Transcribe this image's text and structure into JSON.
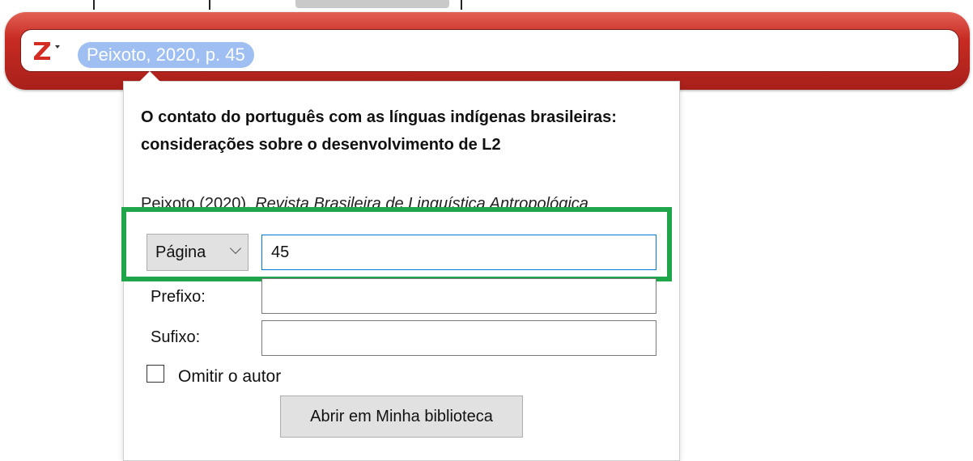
{
  "citation": {
    "bubble_text": "Peixoto, 2020, p. 45",
    "logo_letter": "Z",
    "logo_color": "#d42c23",
    "bar_color": "#b8231c",
    "bubble_color": "#9fbff2"
  },
  "popup": {
    "title": "O contato do português com as línguas indígenas brasileiras: considerações sobre o desenvolvimento de L2",
    "source_author": "Peixoto (2020), ",
    "source_journal": "Revista Brasileira de Linguística Antropológica",
    "locator_label": "Página",
    "locator_value": "45",
    "prefix_label": "Prefixo:",
    "prefix_value": "",
    "suffix_label": "Sufixo:",
    "suffix_value": "",
    "omit_author_label": "Omitir o autor",
    "omit_author_checked": false,
    "open_library_label": "Abrir em Minha biblioteca"
  },
  "highlight_color": "#1fa64a"
}
